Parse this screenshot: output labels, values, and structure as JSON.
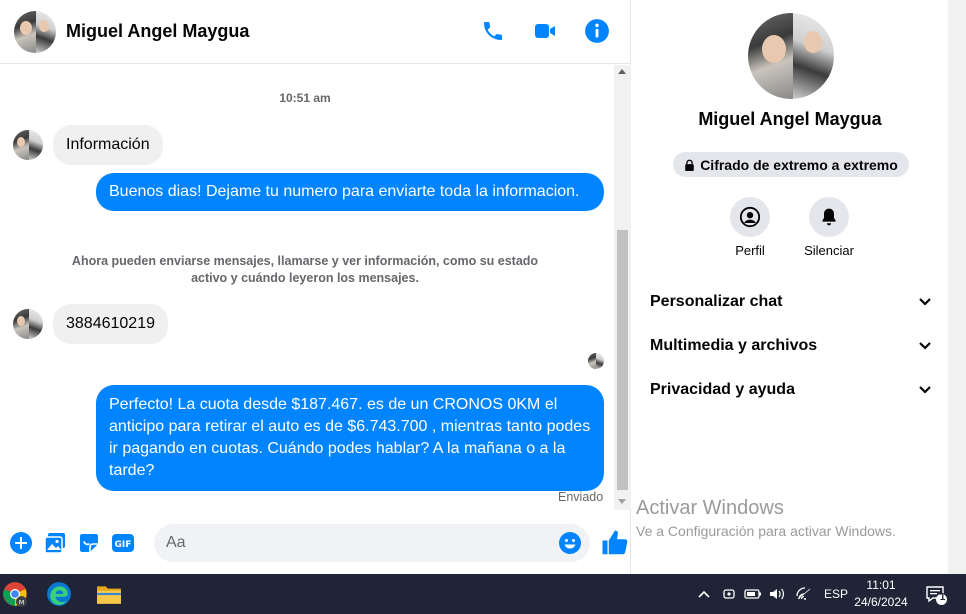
{
  "chat": {
    "contact_name": "Miguel Angel Maygua",
    "timestamp": "10:51 am",
    "messages": {
      "m1": "Información",
      "m2": "Buenos dias! Dejame tu numero para enviarte toda la informacion.",
      "system_note_line1": "Ahora pueden enviarse mensajes, llamarse y ver información, como su estado",
      "system_note_line2": "activo y cuándo leyeron los mensajes.",
      "m3": "3884610219",
      "m4": "Perfecto! La cuota desde $187.467. es de un CRONOS 0KM el anticipo para retirar el auto es de $6.743.700 , mientras tanto podes ir pagando en cuotas. Cuándo podes hablar? A la mañana o a la tarde?"
    },
    "sent_status": "Enviado",
    "composer_placeholder": "Aa"
  },
  "info_panel": {
    "name": "Miguel Angel Maygua",
    "encryption": "Cifrado de extremo a extremo",
    "profile_label": "Perfil",
    "mute_label": "Silenciar",
    "sections": [
      "Personalizar chat",
      "Multimedia y archivos",
      "Privacidad y ayuda"
    ]
  },
  "watermark": {
    "line1": "Activar Windows",
    "line2": "Ve a Configuración para activar Windows."
  },
  "taskbar": {
    "language": "ESP",
    "time": "11:01",
    "date": "24/6/2024",
    "notification_count": "1"
  },
  "colors": {
    "messenger_blue": "#0084ff",
    "taskbar": "#1f2536"
  }
}
